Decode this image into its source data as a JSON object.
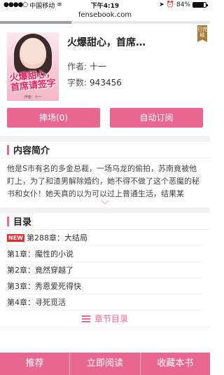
{
  "status": {
    "carrier": "中国移动",
    "time": "下午4:19",
    "battery_text": "84%",
    "battery_level": 0.84
  },
  "browser": {
    "url": "fensebook.com"
  },
  "book": {
    "cover_title": "火爆甜心，首席请签字",
    "cover_author": "作者：十一",
    "title": "火爆甜心，首席…",
    "author_label": "作者:",
    "author": "十一",
    "words_label": "字数:",
    "words": "943456",
    "badge": "已完结"
  },
  "actions": {
    "praise": "捧场(0)",
    "auto_subscribe": "自动订阅"
  },
  "intro": {
    "heading": "内容简介",
    "text": "他是S市有名的多金总裁，一场乌龙的偷拍，苏南竟被他盯上，为了和渣男解除婚约，她不得不做了这个恶魔的秘书和女仆！她天真的以为可以过上普通生活，结果某"
  },
  "toc": {
    "heading": "目录",
    "new_tag": "NEW",
    "latest": "第288章：大结局",
    "chapters": [
      "第1章：魔性的小说",
      "第2章：竟然穿越了",
      "第3章：秀恩爱死得快",
      "第4章：寻死觅活"
    ],
    "more": "章节目录"
  },
  "bottom_nav": {
    "recommend": "推荐",
    "read": "立即阅读",
    "bookmark": "收藏本书"
  },
  "colors": {
    "accent": "#e8678f",
    "badge": "#a57d39",
    "new_tag": "#e02b2b"
  }
}
